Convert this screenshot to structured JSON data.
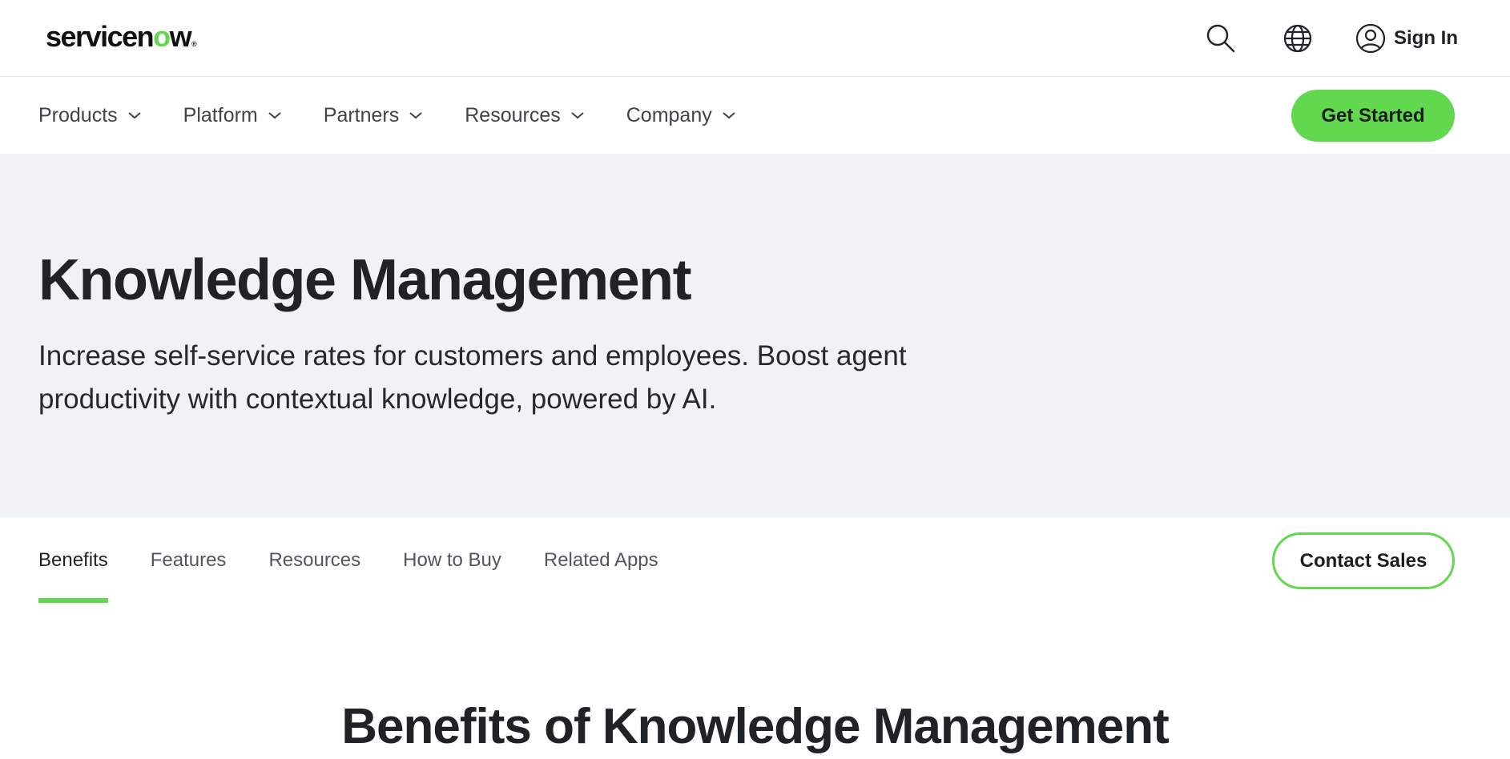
{
  "header": {
    "logo_text": "servicen",
    "logo_o": "o",
    "logo_end": "w",
    "logo_reg": "®",
    "sign_in_label": "Sign In",
    "icons": [
      "search-icon",
      "globe-icon",
      "user-icon"
    ]
  },
  "nav": {
    "items": [
      {
        "label": "Products"
      },
      {
        "label": "Platform"
      },
      {
        "label": "Partners"
      },
      {
        "label": "Resources"
      },
      {
        "label": "Company"
      }
    ],
    "cta_label": "Get Started"
  },
  "hero": {
    "title": "Knowledge Management",
    "description": "Increase self-service rates for customers and employees. Boost agent productivity with contextual knowledge, powered by AI."
  },
  "subnav": {
    "tabs": [
      {
        "label": "Benefits",
        "active": true
      },
      {
        "label": "Features",
        "active": false
      },
      {
        "label": "Resources",
        "active": false
      },
      {
        "label": "How to Buy",
        "active": false
      },
      {
        "label": "Related Apps",
        "active": false
      }
    ],
    "contact_label": "Contact Sales"
  },
  "section": {
    "heading": "Benefits of Knowledge Management"
  },
  "colors": {
    "accent": "#62d84e",
    "hero_bg": "#f0f3f5",
    "text": "#1f2326"
  }
}
